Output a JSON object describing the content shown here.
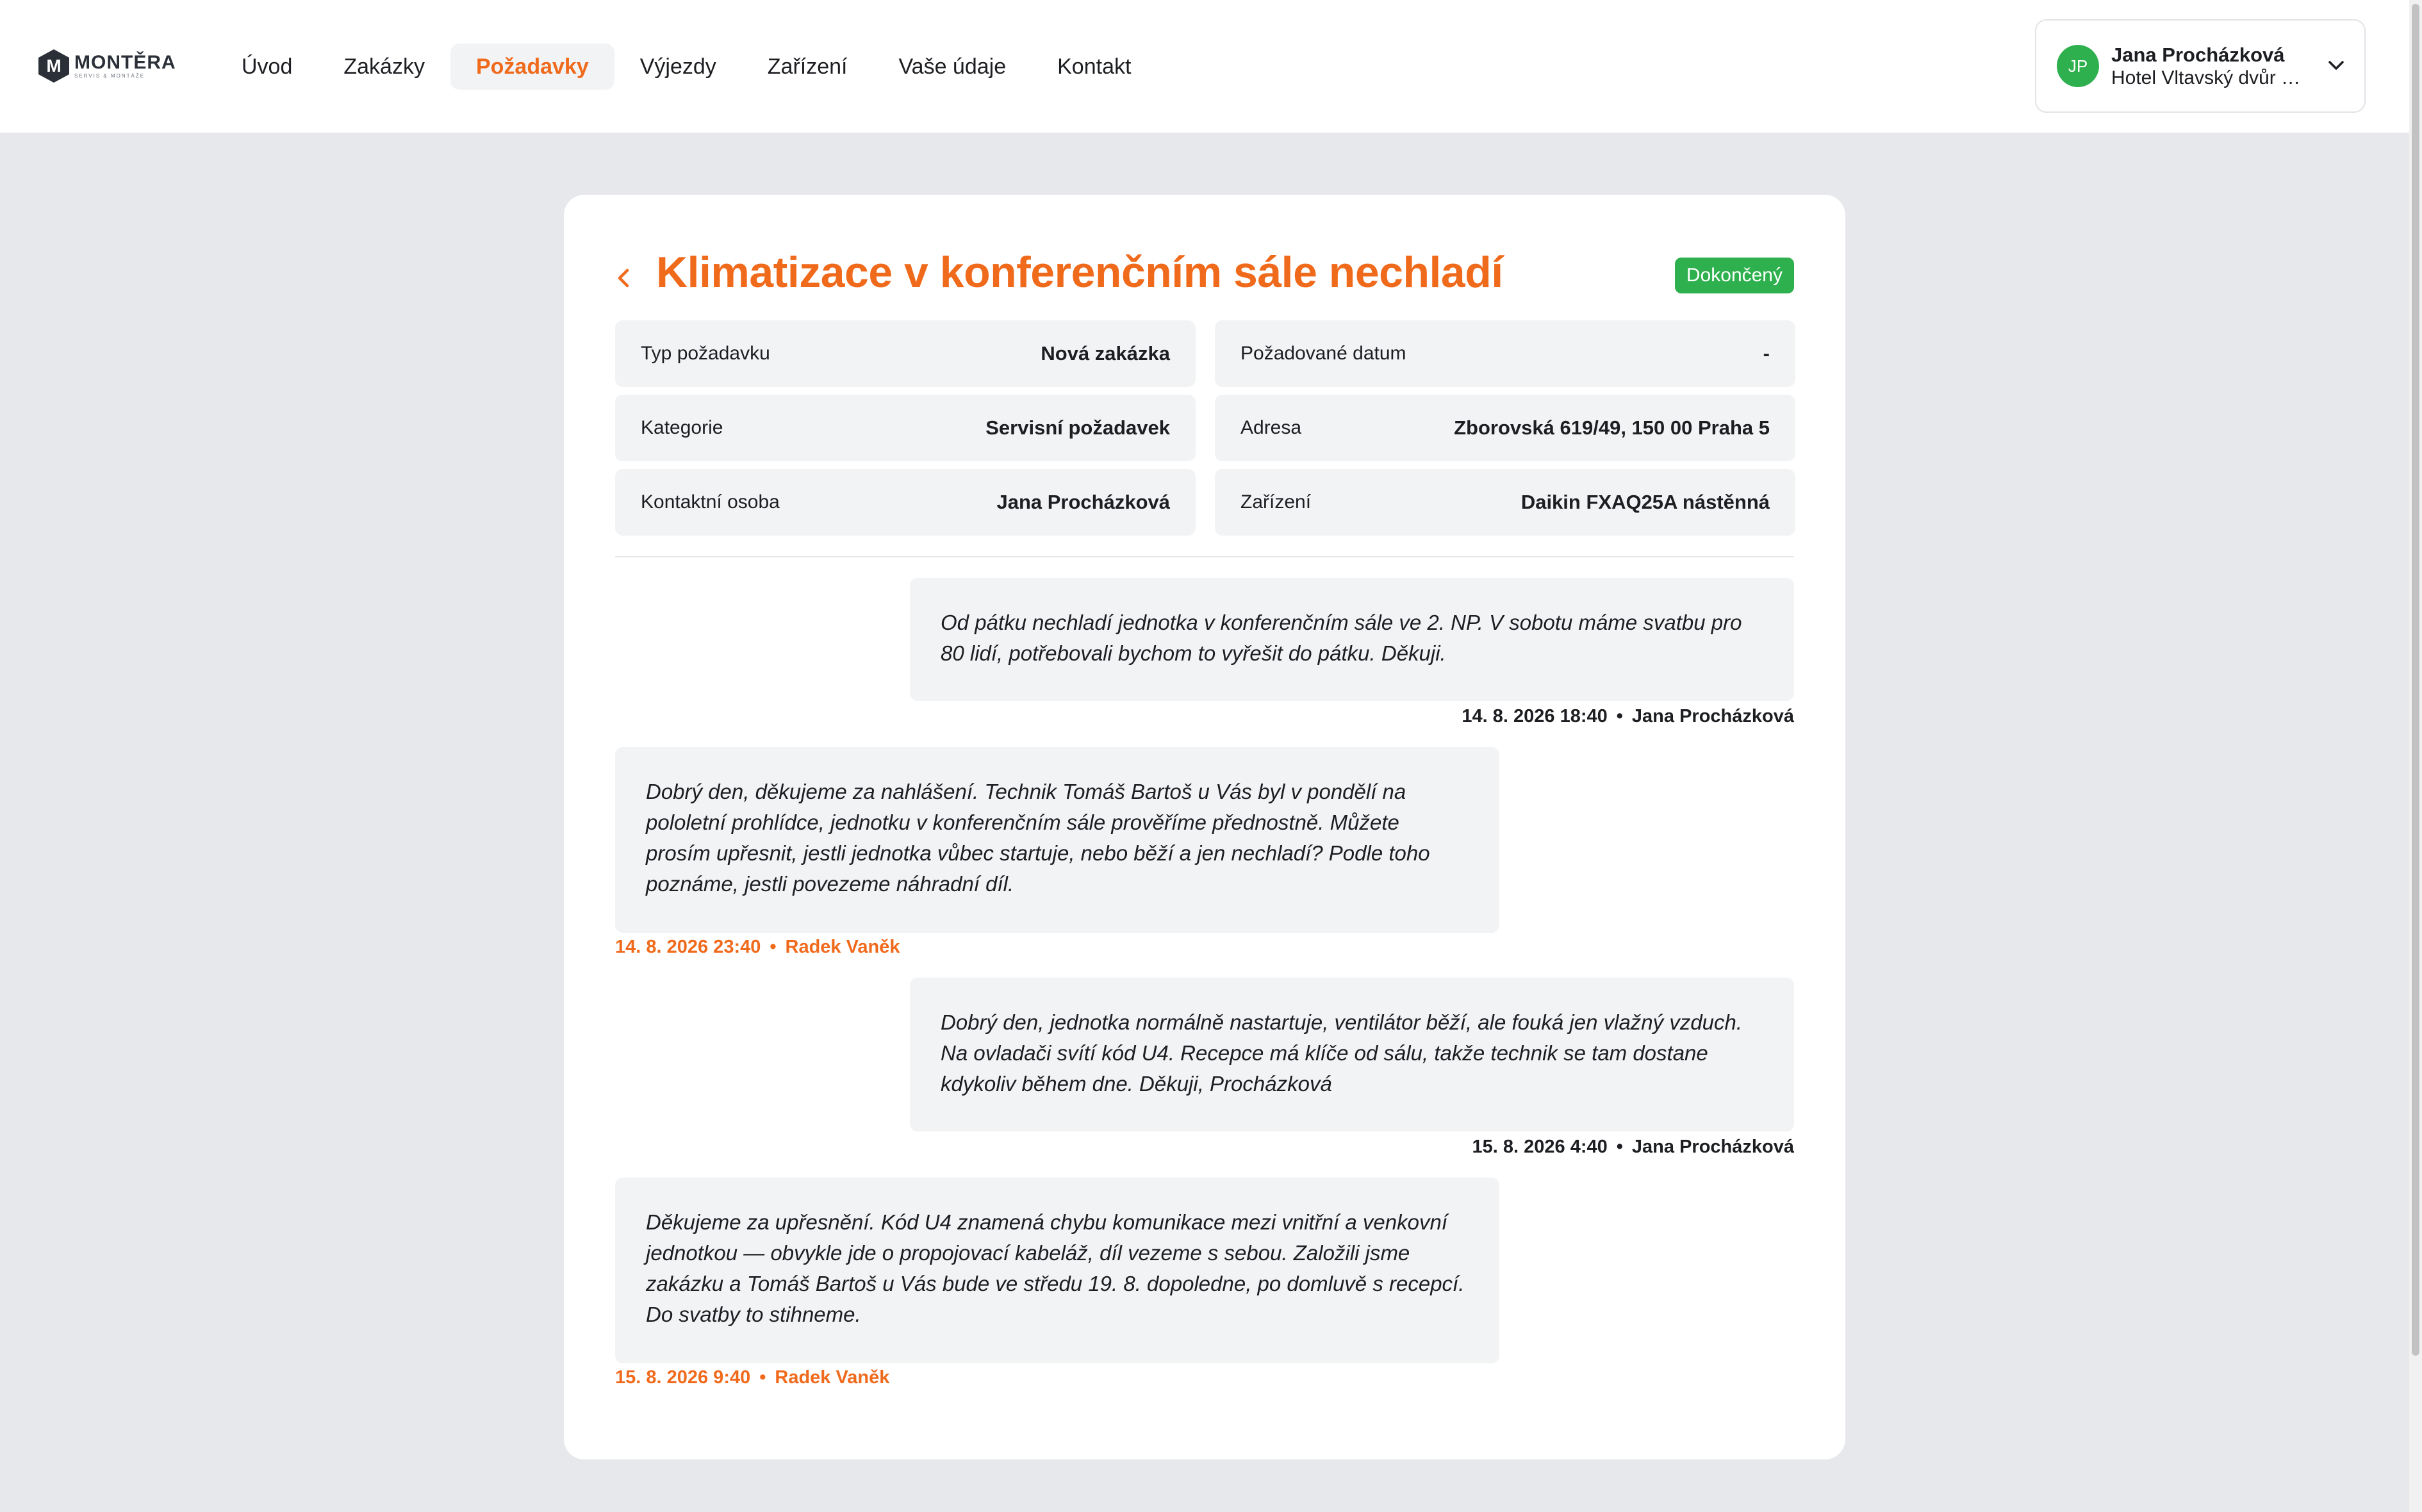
{
  "brand": {
    "logo_letter": "M",
    "name": "MONTĚRA",
    "tagline": "SERVIS & MONTÁŽE"
  },
  "nav": {
    "items": [
      {
        "label": "Úvod"
      },
      {
        "label": "Zakázky"
      },
      {
        "label": "Požadavky",
        "active": true
      },
      {
        "label": "Výjezdy"
      },
      {
        "label": "Zařízení"
      },
      {
        "label": "Vaše údaje"
      },
      {
        "label": "Kontakt"
      }
    ]
  },
  "user": {
    "initials": "JP",
    "name": "Jana Procházková",
    "organization": "Hotel Vltavský dvůr s.r.o.",
    "avatar_color": "#2fb04e"
  },
  "request": {
    "title": "Klimatizace v konferenčním sále nechladí",
    "status": "Dokončený",
    "status_color": "#2fb04e",
    "fields": {
      "type": {
        "label": "Typ požadavku",
        "value": "Nová zakázka"
      },
      "date": {
        "label": "Požadované datum",
        "value": "-"
      },
      "category": {
        "label": "Kategorie",
        "value": "Servisní požadavek"
      },
      "address": {
        "label": "Adresa",
        "value": "Zborovská 619/49, 150 00 Praha 5"
      },
      "contact": {
        "label": "Kontaktní osoba",
        "value": "Jana Procházková"
      },
      "device": {
        "label": "Zařízení",
        "value": "Daikin FXAQ25A nástěnná"
      }
    }
  },
  "messages": [
    {
      "role": "customer",
      "text": "Od pátku nechladí jednotka v konferenčním sále ve 2. NP. V sobotu máme svatbu pro 80 lidí, potřebovali bychom to vyřešit do pátku. Děkuji.",
      "time": "14. 8. 2026 18:40",
      "author": "Jana Procházková"
    },
    {
      "role": "staff",
      "text": "Dobrý den, děkujeme za nahlášení. Technik Tomáš Bartoš u Vás byl v pondělí na pololetní prohlídce, jednotku v konferenčním sále prověříme přednostně. Můžete prosím upřesnit, jestli jednotka vůbec startuje, nebo běží a jen nechladí? Podle toho poznáme, jestli povezeme náhradní díl.",
      "time": "14. 8. 2026 23:40",
      "author": "Radek Vaněk"
    },
    {
      "role": "customer",
      "text": "Dobrý den, jednotka normálně nastartuje, ventilátor běží, ale fouká jen vlažný vzduch. Na ovladači svítí kód U4. Recepce má klíče od sálu, takže technik se tam dostane kdykoliv během dne. Děkuji, Procházková",
      "time": "15. 8. 2026 4:40",
      "author": "Jana Procházková"
    },
    {
      "role": "staff",
      "text": "Děkujeme za upřesnění. Kód U4 znamená chybu komunikace mezi vnitřní a venkovní jednotkou — obvykle jde o propojovací kabeláž, díl vezeme s sebou. Založili jsme zakázku a Tomáš Bartoš u Vás bude ve středu 19. 8. dopoledne, po domluvě s recepcí. Do svatby to stihneme.",
      "time": "15. 8. 2026 9:40",
      "author": "Radek Vaněk"
    }
  ],
  "colors": {
    "accent": "#f06a1c",
    "page_background": "#e7e8eb",
    "field_background": "#f2f3f5"
  },
  "icons": {
    "back": "chevron-left-icon",
    "user_menu": "chevron-down-icon"
  }
}
